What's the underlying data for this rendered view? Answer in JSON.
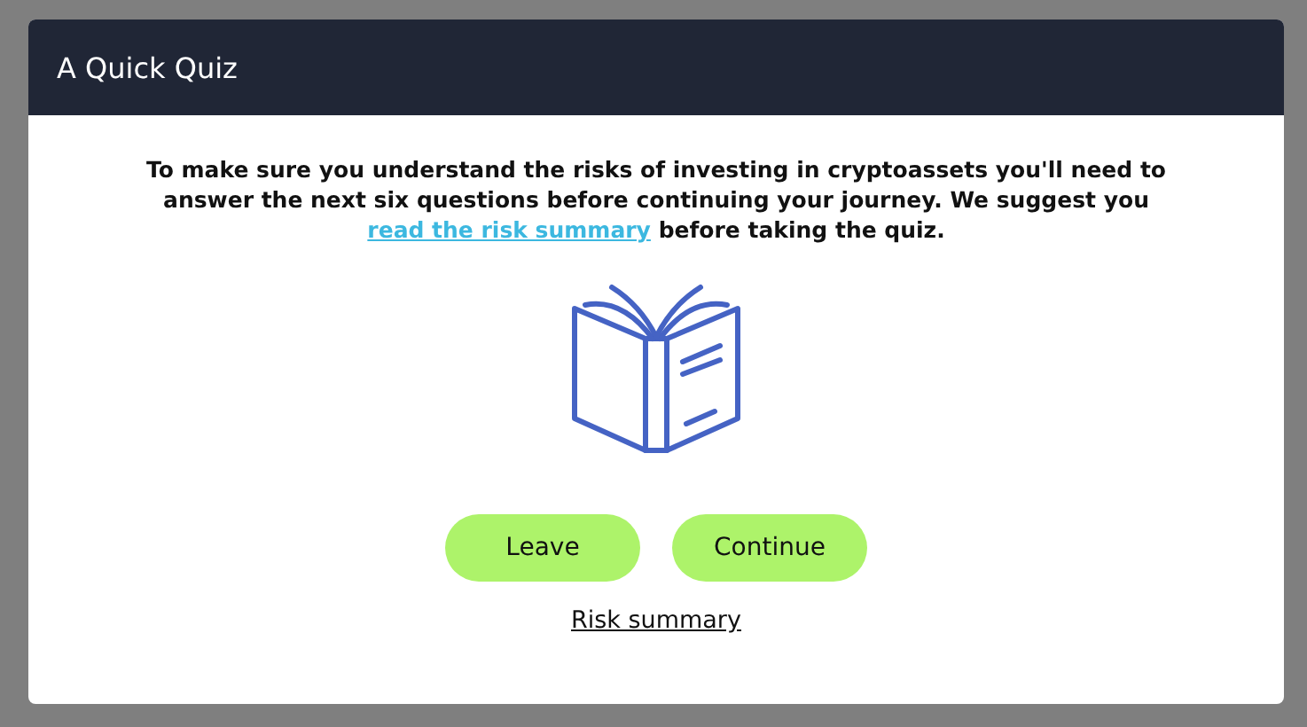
{
  "dialog": {
    "title": "A Quick Quiz",
    "intro": {
      "before": "To make sure you understand the risks of investing in cryptoassets you'll need to answer the next six questions before continuing your journey. We suggest you",
      "link": "read the risk summary",
      "after": "before taking the quiz."
    },
    "buttons": [
      "Leave",
      "Continue"
    ],
    "footer_link": "Risk summary"
  }
}
